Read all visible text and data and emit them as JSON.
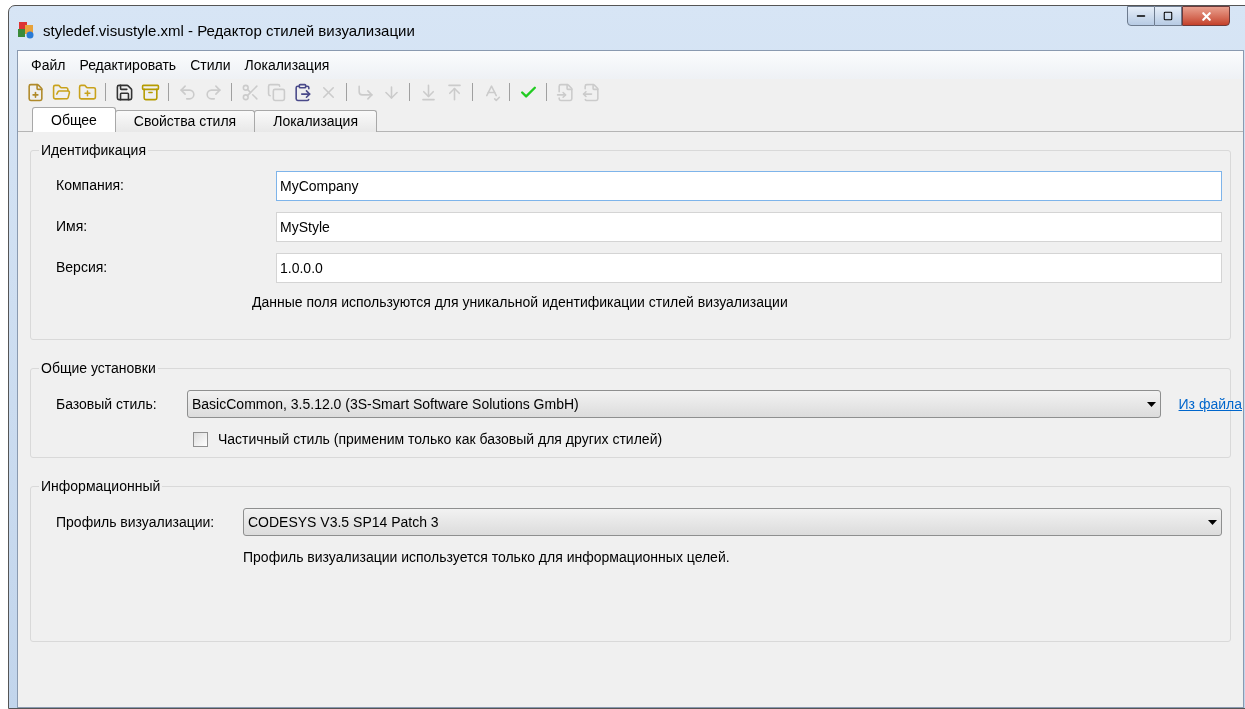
{
  "window": {
    "title": "styledef.visustyle.xml - Редактор стилей визуализации"
  },
  "menu": [
    "Файл",
    "Редактировать",
    "Стили",
    "Локализация"
  ],
  "toolbar": [
    [
      {
        "kind": "new",
        "disabled": false
      },
      {
        "kind": "open",
        "disabled": false
      },
      {
        "kind": "open-add",
        "disabled": false
      }
    ],
    [
      {
        "kind": "save",
        "disabled": false
      },
      {
        "kind": "cabinet",
        "disabled": false
      }
    ],
    [
      {
        "kind": "undo",
        "disabled": true
      },
      {
        "kind": "redo",
        "disabled": true
      }
    ],
    [
      {
        "kind": "cut",
        "disabled": true
      },
      {
        "kind": "copy",
        "disabled": true
      },
      {
        "kind": "paste",
        "disabled": false
      },
      {
        "kind": "delete",
        "disabled": true
      }
    ],
    [
      {
        "kind": "add-child",
        "disabled": true
      },
      {
        "kind": "add-below",
        "disabled": true
      }
    ],
    [
      {
        "kind": "move-down",
        "disabled": true
      },
      {
        "kind": "move-up",
        "disabled": true
      }
    ],
    [
      {
        "kind": "sort",
        "disabled": true
      }
    ],
    [
      {
        "kind": "check",
        "disabled": false
      }
    ],
    [
      {
        "kind": "import",
        "disabled": true
      },
      {
        "kind": "export",
        "disabled": true
      }
    ]
  ],
  "tabs": [
    {
      "label": "Общее",
      "selected": true
    },
    {
      "label": "Свойства стиля",
      "selected": false
    },
    {
      "label": "Локализация",
      "selected": false
    }
  ],
  "groups": [
    {
      "title": "Идентификация",
      "rows": [
        {
          "kind": "text",
          "label": "Компания:",
          "value": "MyCompany",
          "focused": true
        },
        {
          "kind": "text",
          "label": "Имя:",
          "value": "MyStyle",
          "focused": false
        },
        {
          "kind": "text",
          "label": "Версия:",
          "value": "1.0.0.0",
          "focused": false
        },
        {
          "kind": "note",
          "text": "Данные поля используются для уникальной идентификации стилей визуализации"
        }
      ]
    },
    {
      "title": "Общие установки",
      "rows": [
        {
          "kind": "dropdown",
          "label": "Базовый стиль:",
          "value": "BasicCommon, 3.5.12.0 (3S-Smart Software Solutions GmbH)",
          "link": "Из файла"
        },
        {
          "kind": "checkbox",
          "label": "Частичный стиль (применим только как базовый для других стилей)",
          "checked": false
        }
      ]
    },
    {
      "title": "Информационный",
      "rows": [
        {
          "kind": "dropdown",
          "label": "Профиль визуализации:",
          "value": "CODESYS V3.5 SP14 Patch 3"
        },
        {
          "kind": "note",
          "text": "Профиль визуализации используется только для информационных целей."
        }
      ]
    }
  ]
}
